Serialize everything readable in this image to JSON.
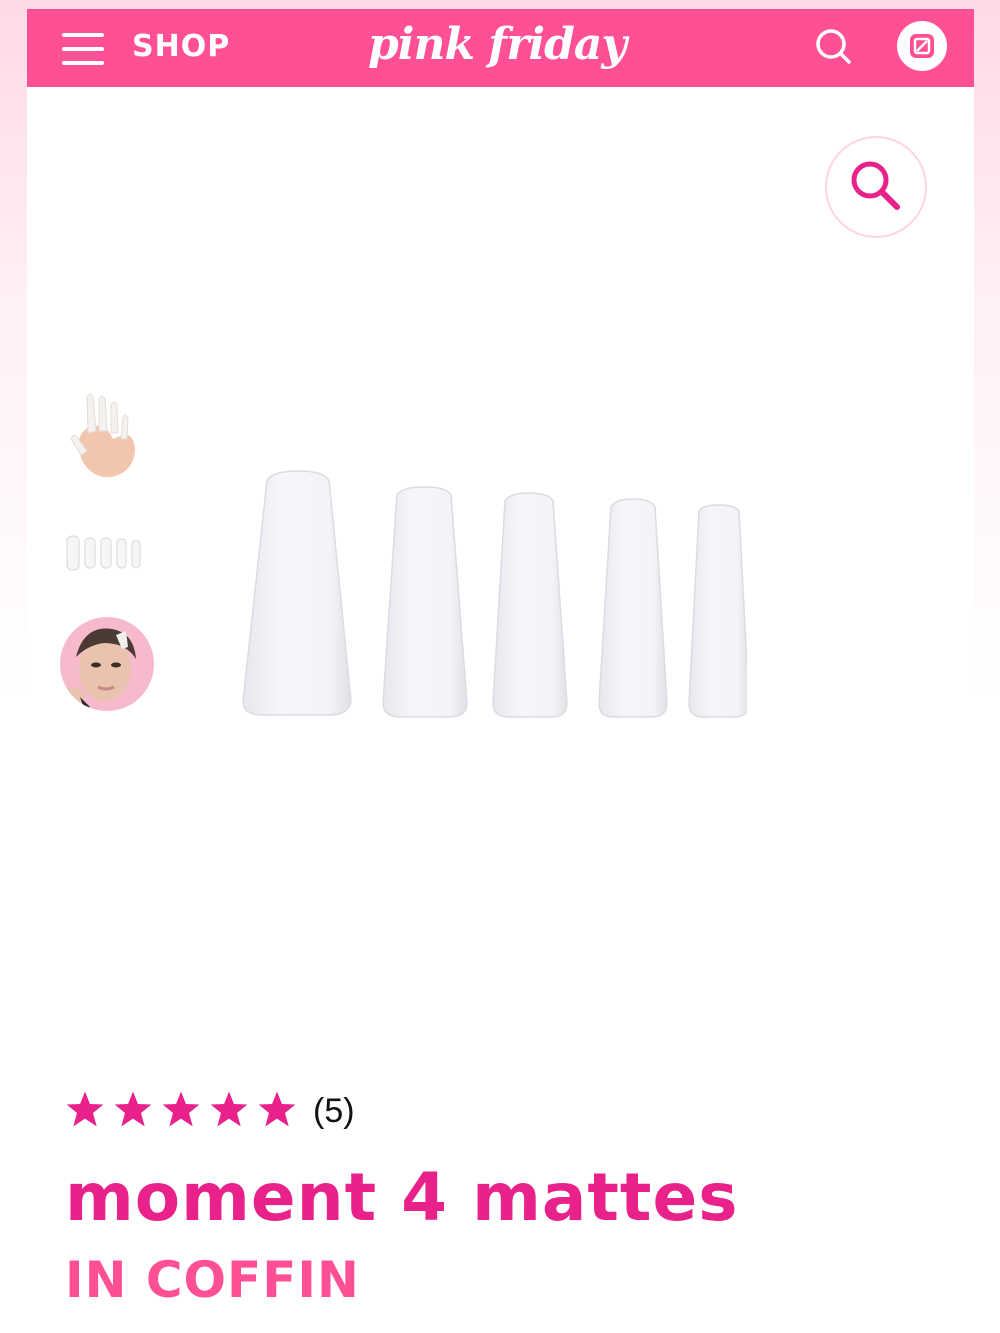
{
  "colors": {
    "accent": "#ff4f95",
    "title": "#e8228a",
    "star": "#e8228a"
  },
  "header": {
    "shop_label": "SHOP",
    "logo_text": "pink friday",
    "icons": [
      "menu-icon",
      "search-icon",
      "cart-icon"
    ]
  },
  "gallery": {
    "zoom_icon": "magnifier-icon",
    "thumbnails": [
      "hand-with-nails-thumbnail",
      "nail-set-thumbnail",
      "model-portrait-thumbnail"
    ],
    "main_image": "five-white-coffin-nails"
  },
  "product": {
    "rating": 5,
    "rating_max": 5,
    "review_count": "(5)",
    "name": "moment 4 mattes",
    "shape": "IN COFFIN"
  }
}
